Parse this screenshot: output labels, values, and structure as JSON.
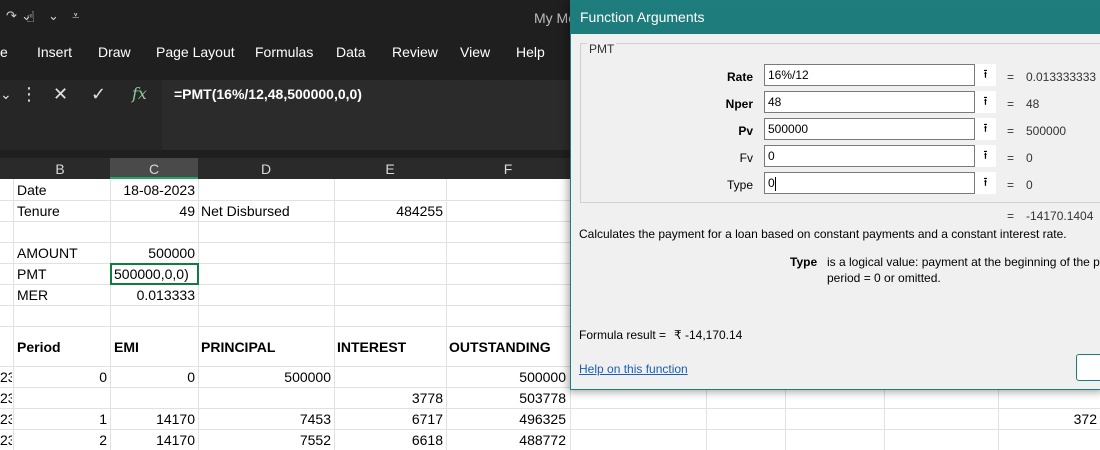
{
  "titlebar": {
    "app_title": "My Mo",
    "qat_items": [
      {
        "icon": "redo-icon",
        "glyph": "↷"
      },
      {
        "icon": "dropdown-icon",
        "glyph": "⌄"
      },
      {
        "icon": "touch-mode-icon",
        "glyph": "☝"
      },
      {
        "icon": "dropdown-icon",
        "glyph": "⌄"
      },
      {
        "icon": "customize-qat-icon",
        "glyph": "⩡"
      }
    ]
  },
  "ribbon": {
    "tabs": [
      "e",
      "Insert",
      "Draw",
      "Page Layout",
      "Formulas",
      "Data",
      "Review",
      "View",
      "Help"
    ]
  },
  "formula_bar": {
    "more_glyph": "⋮",
    "cancel_glyph": "✕",
    "enter_glyph": "✓",
    "fx_label": "fx",
    "formula": "=PMT(16%/12,48,500000,0,0)"
  },
  "columns": [
    "B",
    "C",
    "D",
    "E",
    "F"
  ],
  "cells": {
    "date_label": "Date",
    "date_value": "18-08-2023",
    "tenure_label": "Tenure",
    "tenure_value": "49",
    "net_disbursed_label": "Net Disbursed",
    "net_disbursed_value": "484255",
    "amount_label": "AMOUNT",
    "amount_value": "500000",
    "pmt_label": "PMT",
    "pmt_edit_value": "500000,0,0)",
    "mer_label": "MER",
    "mer_value": "0.013333"
  },
  "table": {
    "headers": [
      "Period",
      "EMI",
      "PRINCIPAL",
      "INTEREST",
      "OUTSTANDING"
    ],
    "rows": [
      {
        "a": "23",
        "period": "0",
        "emi": "0",
        "principal": "500000",
        "interest": "",
        "outstanding": "500000"
      },
      {
        "a": "23",
        "period": "",
        "emi": "",
        "principal": "",
        "interest": "3778",
        "outstanding": "503778"
      },
      {
        "a": "23",
        "period": "1",
        "emi": "14170",
        "principal": "7453",
        "interest": "6717",
        "outstanding": "496325"
      },
      {
        "a": "23",
        "period": "2",
        "emi": "14170",
        "principal": "7552",
        "interest": "6618",
        "outstanding": "488772"
      }
    ],
    "offscreen_value": "372"
  },
  "dialog": {
    "title": "Function Arguments",
    "function_name": "PMT",
    "args": [
      {
        "label": "Rate",
        "input": "16%/12",
        "value": "0.013333333",
        "bold": true
      },
      {
        "label": "Nper",
        "input": "48",
        "value": "48",
        "bold": true
      },
      {
        "label": "Pv",
        "input": "500000",
        "value": "500000",
        "bold": true
      },
      {
        "label": "Fv",
        "input": "0",
        "value": "0",
        "bold": false
      },
      {
        "label": "Type",
        "input": "0",
        "value": "0",
        "bold": false
      }
    ],
    "equals": "=",
    "collapse_glyph": "⭱",
    "result_value": "-14170.1404",
    "description": "Calculates the payment for a loan based on constant payments and a constant interest rate.",
    "arg_help_name": "Type",
    "arg_help_line1": "is a logical value: payment at the beginning of the perio",
    "arg_help_line2": "period = 0 or omitted.",
    "formula_result_label": "Formula result =",
    "formula_result_value": "₹ -14,170.14",
    "help_link": "Help on this function"
  }
}
